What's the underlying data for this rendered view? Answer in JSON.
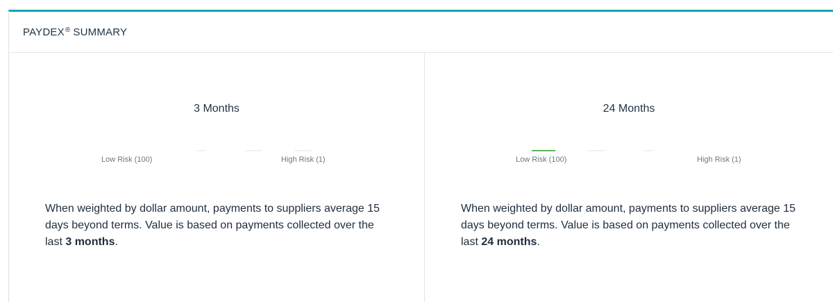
{
  "header": {
    "title_brand": "PAYDEX",
    "title_mark": "®",
    "title_rest": "SUMMARY"
  },
  "panels": [
    {
      "title": "3 Months",
      "low_label": "Low Risk (100)",
      "high_label": "High Risk (1)",
      "description_prefix": "When weighted by dollar amount, payments to suppliers average 15 days beyond terms. Value is based on payments collected over the last ",
      "description_period": "3 months",
      "description_suffix": "."
    },
    {
      "title": "24 Months",
      "low_label": "Low Risk (100)",
      "high_label": "High Risk (1)",
      "description_prefix": "When weighted by dollar amount, payments to suppliers average 15 days beyond terms. Value is based on payments collected over the last ",
      "description_period": "24 months",
      "description_suffix": "."
    }
  ],
  "colors": {
    "accent": "#17a2b8",
    "low_risk_highlight": "#5cb85c"
  }
}
